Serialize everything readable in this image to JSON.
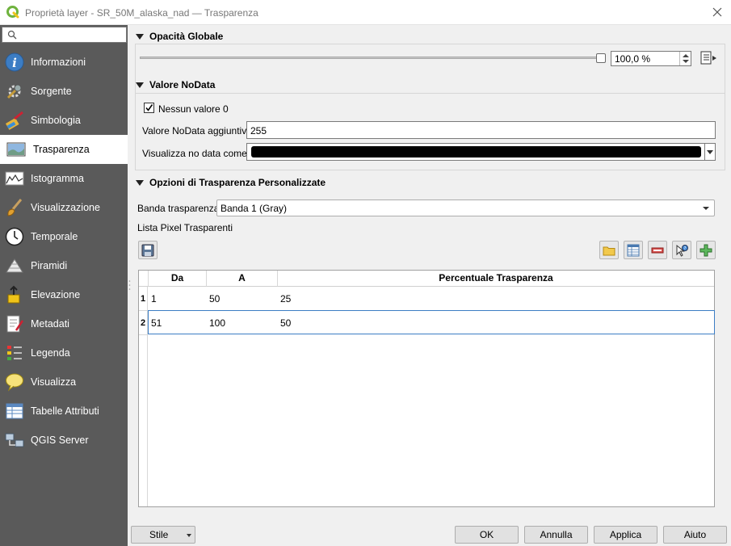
{
  "window": {
    "title": "Proprietà layer - SR_50M_alaska_nad — Trasparenza"
  },
  "search": {
    "placeholder": ""
  },
  "sidebar": {
    "items": [
      {
        "label": "Informazioni",
        "icon": "info-icon"
      },
      {
        "label": "Sorgente",
        "icon": "source-wrench-icon"
      },
      {
        "label": "Simbologia",
        "icon": "symbology-brush-icon"
      },
      {
        "label": "Trasparenza",
        "icon": "transparency-icon"
      },
      {
        "label": "Istogramma",
        "icon": "histogram-icon"
      },
      {
        "label": "Visualizzazione",
        "icon": "rendering-brush-icon"
      },
      {
        "label": "Temporale",
        "icon": "clock-icon"
      },
      {
        "label": "Piramidi",
        "icon": "pyramids-icon"
      },
      {
        "label": "Elevazione",
        "icon": "elevation-icon"
      },
      {
        "label": "Metadati",
        "icon": "metadata-icon"
      },
      {
        "label": "Legenda",
        "icon": "legend-icon"
      },
      {
        "label": "Visualizza",
        "icon": "display-speech-icon"
      },
      {
        "label": "Tabelle Attributi",
        "icon": "attribute-table-icon"
      },
      {
        "label": "QGIS Server",
        "icon": "qgis-server-icon"
      }
    ],
    "active_index": 3
  },
  "opacity": {
    "header": "Opacità Globale",
    "value_text": "100,0 %",
    "level": 1.0
  },
  "nodata": {
    "header": "Valore NoData",
    "no_value_label": "Nessun valore",
    "no_value_checked": true,
    "no_value_number": "0",
    "additional_label": "Valore NoData aggiuntivo",
    "additional_value": "255",
    "display_label": "Visualizza no data come",
    "display_color": "#000000"
  },
  "custom": {
    "header": "Opzioni di Trasparenza Personalizzate",
    "band_label": "Banda trasparenza",
    "band_value": "Banda 1 (Gray)",
    "pixel_list_label": "Lista Pixel Trasparenti",
    "columns": [
      "Da",
      "A",
      "Percentuale Trasparenza"
    ],
    "rows": [
      {
        "num": "1",
        "from": "1",
        "to": "50",
        "pct": "25"
      },
      {
        "num": "2",
        "from": "51",
        "to": "100",
        "pct": "50"
      }
    ]
  },
  "buttons": {
    "style": "Stile",
    "ok": "OK",
    "cancel": "Annulla",
    "apply": "Applica",
    "help": "Aiuto"
  },
  "colors": {
    "sidebar_bg": "#5a5a5a",
    "accent": "#3c7dc4"
  }
}
